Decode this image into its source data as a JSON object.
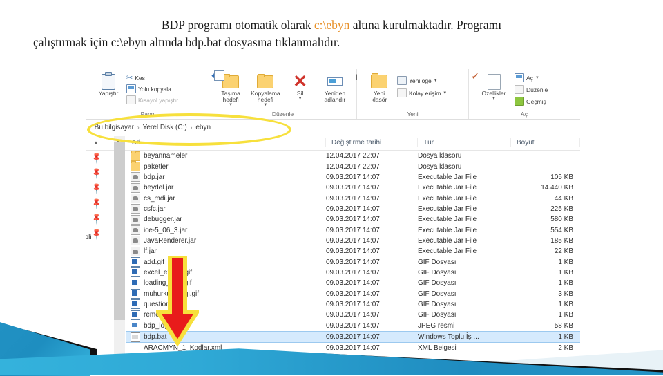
{
  "slide": {
    "caption_part1": "BDP programı otomatik olarak ",
    "caption_highlight": "c:\\ebyn",
    "caption_part2": " altına kurulmaktadır. Programı",
    "caption_line2": "çalıştırmak için c:\\ebyn altında bdp.bat dosyasına tıklanmalıdır.",
    "highlight_color": "#e8912a"
  },
  "explorer": {
    "ribbon": {
      "groups": [
        {
          "label": "Pano",
          "big": [
            {
              "label": "Yapıştır",
              "icon": "clipboard-icon"
            }
          ],
          "small": [
            {
              "label": "Kes",
              "icon": "scissors-icon",
              "dim": false
            },
            {
              "label": "Yolu kopyala",
              "icon": "copy-path-icon",
              "dim": false
            },
            {
              "label": "Kısayol yapıştır",
              "icon": "paste-shortcut-icon",
              "dim": true
            }
          ]
        },
        {
          "label": "Düzenle",
          "big": [
            {
              "label": "Taşıma\nhedefi",
              "icon": "move-to-icon",
              "caret": true
            },
            {
              "label": "Kopyalama\nhedefi",
              "icon": "copy-to-icon",
              "caret": true
            },
            {
              "label": "Sil",
              "icon": "delete-icon",
              "caret": true
            },
            {
              "label": "Yeniden\nadlandır",
              "icon": "rename-icon",
              "caret": false
            }
          ],
          "small": []
        },
        {
          "label": "Yeni",
          "big": [
            {
              "label": "Yeni\nklasör",
              "icon": "new-folder-icon"
            }
          ],
          "small": [
            {
              "label": "Yeni öğe",
              "icon": "new-item-icon",
              "caret": true
            },
            {
              "label": "Kolay erişim",
              "icon": "easy-access-icon",
              "caret": true
            }
          ]
        },
        {
          "label": "Aç",
          "big": [
            {
              "label": "Özellikler",
              "icon": "properties-icon",
              "caret": true
            }
          ],
          "small": [
            {
              "label": "Aç",
              "icon": "open-icon",
              "caret": true
            },
            {
              "label": "Düzenle",
              "icon": "edit-icon",
              "caret": false
            },
            {
              "label": "Geçmiş",
              "icon": "history-icon",
              "caret": false
            }
          ]
        }
      ]
    },
    "address_bar": {
      "crumbs": [
        "Bu bilgisayar",
        "Yerel Disk (C:)",
        "ebyn"
      ],
      "separator": "›"
    },
    "columns": [
      {
        "label": "Ad"
      },
      {
        "label": "Değiştirme tarihi"
      },
      {
        "label": "Tür"
      },
      {
        "label": "Boyut"
      }
    ],
    "nav_pane": {
      "truncated_label": "ebli"
    },
    "files": [
      {
        "name": "beyannameler",
        "date": "12.04.2017 22:07",
        "type": "Dosya klasörü",
        "size": "",
        "icon": "folder-icon"
      },
      {
        "name": "paketler",
        "date": "12.04.2017 22:07",
        "type": "Dosya klasörü",
        "size": "",
        "icon": "folder-icon"
      },
      {
        "name": "bdp.jar",
        "date": "09.03.2017 14:07",
        "type": "Executable Jar File",
        "size": "105 KB",
        "icon": "jar-icon"
      },
      {
        "name": "beydel.jar",
        "date": "09.03.2017 14:07",
        "type": "Executable Jar File",
        "size": "14.440 KB",
        "icon": "jar-icon"
      },
      {
        "name": "cs_mdi.jar",
        "date": "09.03.2017 14:07",
        "type": "Executable Jar File",
        "size": "44 KB",
        "icon": "jar-icon"
      },
      {
        "name": "csfc.jar",
        "date": "09.03.2017 14:07",
        "type": "Executable Jar File",
        "size": "225 KB",
        "icon": "jar-icon"
      },
      {
        "name": "debugger.jar",
        "date": "09.03.2017 14:07",
        "type": "Executable Jar File",
        "size": "580 KB",
        "icon": "jar-icon"
      },
      {
        "name": "ice-5_06_3.jar",
        "date": "09.03.2017 14:07",
        "type": "Executable Jar File",
        "size": "554 KB",
        "icon": "jar-icon"
      },
      {
        "name": "JavaRenderer.jar",
        "date": "09.03.2017 14:07",
        "type": "Executable Jar File",
        "size": "185 KB",
        "icon": "jar-icon"
      },
      {
        "name": "lf.jar",
        "date": "09.03.2017 14:07",
        "type": "Executable Jar File",
        "size": "22 KB",
        "icon": "jar-icon"
      },
      {
        "name": "add.gif",
        "date": "09.03.2017 14:07",
        "type": "GIF Dosyası",
        "size": "1 KB",
        "icon": "gif-icon"
      },
      {
        "name": "excel_export.gif",
        "date": "09.03.2017 14:07",
        "type": "GIF Dosyası",
        "size": "1 KB",
        "icon": "gif-icon"
      },
      {
        "name": "loading_icon.gif",
        "date": "09.03.2017 14:07",
        "type": "GIF Dosyası",
        "size": "1 KB",
        "icon": "gif-icon"
      },
      {
        "name": "muhurkullanligi.gif",
        "date": "09.03.2017 14:07",
        "type": "GIF Dosyası",
        "size": "3 KB",
        "icon": "gif-icon"
      },
      {
        "name": "question.gif",
        "date": "09.03.2017 14:07",
        "type": "GIF Dosyası",
        "size": "1 KB",
        "icon": "gif-icon"
      },
      {
        "name": "remove.gif",
        "date": "09.03.2017 14:07",
        "type": "GIF Dosyası",
        "size": "1 KB",
        "icon": "gif-icon"
      },
      {
        "name": "bdp_logo.jpg",
        "date": "09.03.2017 14:07",
        "type": "JPEG resmi",
        "size": "58 KB",
        "icon": "jpg-icon"
      },
      {
        "name": "bdp.bat",
        "date": "09.03.2017 14:07",
        "type": "Windows Toplu İş ...",
        "size": "1 KB",
        "icon": "bat-icon",
        "selected": true
      },
      {
        "name": "ARACMYN_1_Kodlar.xml",
        "date": "09.03.2017 14:07",
        "type": "XML Belgesi",
        "size": "2 KB",
        "icon": "xml-icon"
      }
    ]
  },
  "annotations": {
    "ellipse_color": "#f7e03c",
    "arrow_fill": "#e81b1b",
    "arrow_stroke": "#f7e03c"
  }
}
